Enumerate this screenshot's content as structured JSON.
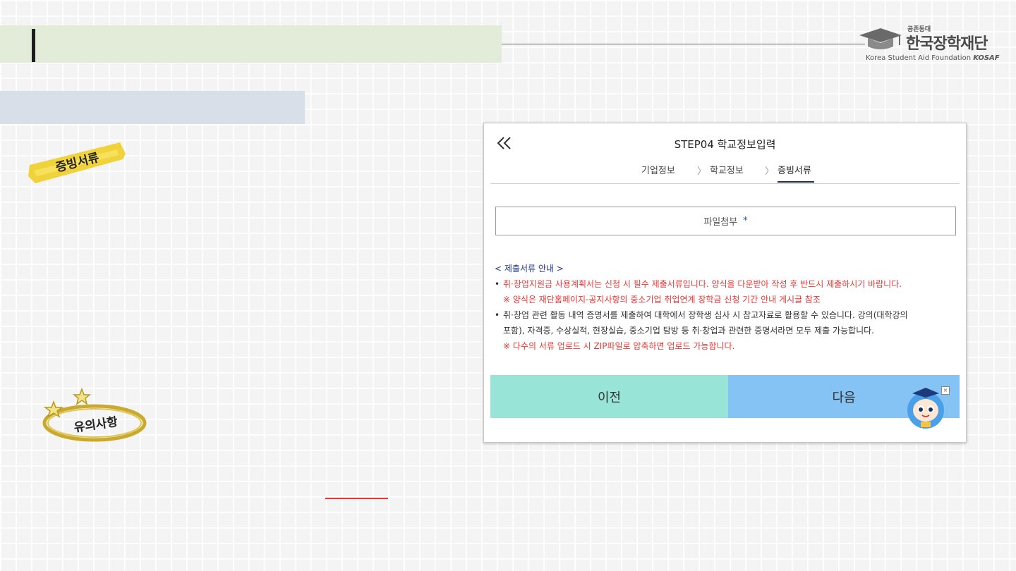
{
  "logo": {
    "top_small": "공존동대",
    "name_ko": "한국장학재단",
    "name_en": "Korea Student Aid Foundation",
    "name_en_abbr": "KOSAF"
  },
  "stickers": {
    "documents": "증빙서류",
    "cautions": "유의사항"
  },
  "panel": {
    "title": "STEP04 학교정보입력",
    "steps": [
      "기업정보",
      "학교정보",
      "증빙서류"
    ],
    "active_step": "증빙서류",
    "file_attach_label": "파일첨부",
    "required_mark": "*",
    "notice": {
      "heading": "< 제출서류 안내 >",
      "line1": "취·창업지원금 사용계획서는 신청 시 필수 제출서류입니다. 양식을 다운받아 작성 후 반드시 제출하시기 바랍니다.",
      "line2": "※  양식은 재단홈페이지-공지사항의 중소기업 취업연계 장학금 신청 기간 안내 게시글 참조",
      "line3": "취·창업 관련 활동 내역 증명서를 제출하여 대학에서 장학생 심사 시 참고자료로 활용할 수 있습니다. 강의(대학강의",
      "line4": "포함), 자격증, 수상실적, 현장실습, 중소기업 탐방 등 취·창업과 관련한 증명서라면 모두 제출 가능합니다.",
      "line5": "※  다수의 서류 업로드 시 ZIP파일로 압축하면 업로드 가능합니다."
    },
    "prev_label": "이전",
    "next_label": "다음",
    "close_mark": "×"
  },
  "colors": {
    "title_band": "#e3ebd9",
    "sub_band": "#d9dfe9",
    "prev_button": "#98e4d7",
    "next_button": "#86c3f5",
    "notice_red": "#e53935",
    "notice_heading": "#1e3a8a",
    "required_blue": "#1e57c8"
  },
  "icons": {
    "back": "double-chevron-left-icon",
    "step_separator": "chevron-right-icon",
    "logo_mark": "graduation-cap-icon",
    "mascot": "mascot-character-icon"
  }
}
